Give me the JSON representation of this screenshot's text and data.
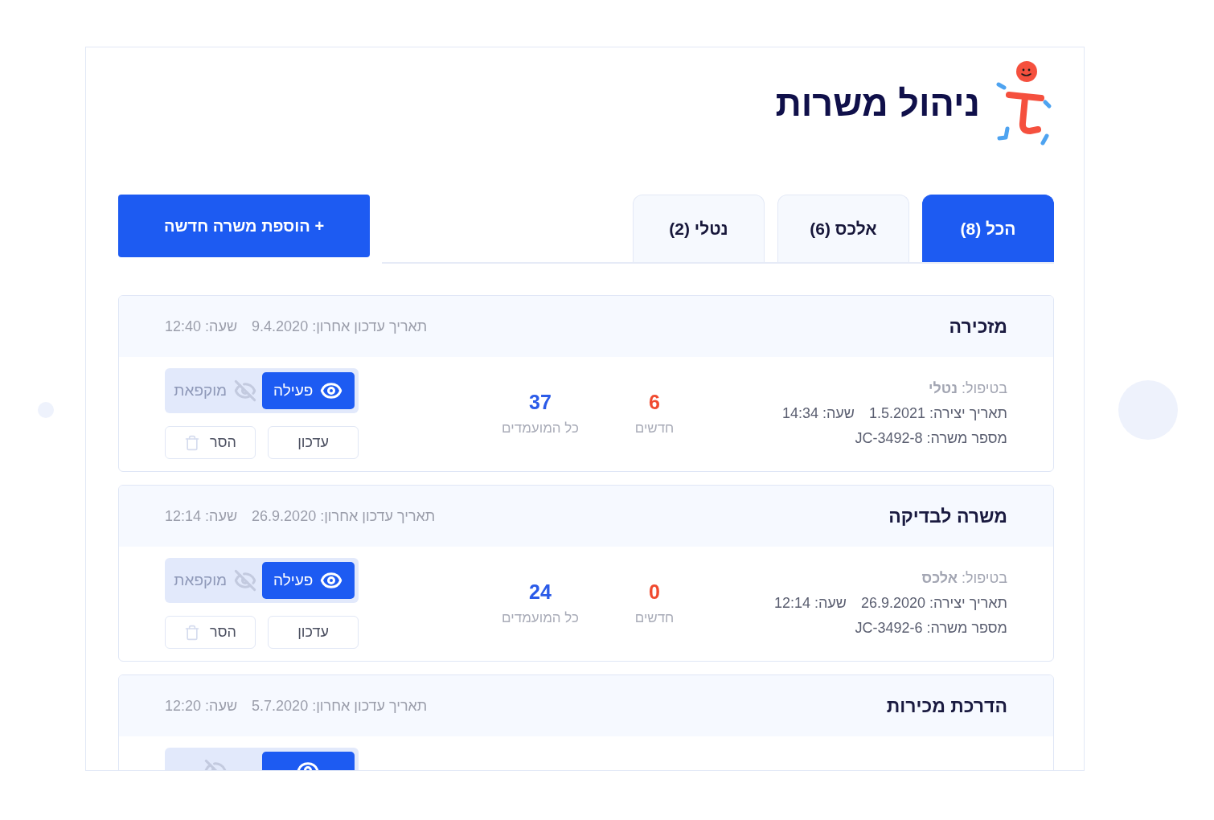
{
  "header": {
    "title": "ניהול משרות"
  },
  "tabs": [
    {
      "label": "הכל (8)",
      "selected": true
    },
    {
      "label": "אלכס (6)",
      "selected": false
    },
    {
      "label": "נטלי (2)",
      "selected": false
    }
  ],
  "add_button": {
    "label": "+ הוספת משרה חדשה"
  },
  "jobs": [
    {
      "title": "מזכירה",
      "last_update": "תאריך עדכון אחרון: 9.4.2020",
      "update_time": "שעה: 12:40",
      "assignee": "בטיפול: **נטלי**",
      "created": "תאריך יצירה: 1.5.2021",
      "created_time": "שעה: 14:34",
      "job_number": "מספר משרה: JC-3492-8",
      "stats": [
        {
          "kind": "new",
          "value": "6",
          "label": "חדשים"
        },
        {
          "kind": "total",
          "value": "37",
          "label": "כל המועמדים"
        }
      ],
      "status_options": [
        {
          "kind": "active",
          "label": "פעילה",
          "selected": true
        },
        {
          "kind": "frozen",
          "label": "מוקפאת",
          "selected": false
        }
      ],
      "actions": [
        {
          "kind": "edit",
          "label": "עדכון"
        },
        {
          "kind": "remove",
          "label": "הסר"
        }
      ]
    },
    {
      "title": "משרה לבדיקה",
      "last_update": "תאריך עדכון אחרון: 26.9.2020",
      "update_time": "שעה: 12:14",
      "assignee": "בטיפול: **אלכס**",
      "created": "תאריך יצירה: 26.9.2020",
      "created_time": "שעה: 12:14",
      "job_number": "מספר משרה: JC-3492-6",
      "stats": [
        {
          "kind": "new",
          "value": "0",
          "label": "חדשים"
        },
        {
          "kind": "total",
          "value": "24",
          "label": "כל המועמדים"
        }
      ],
      "status_options": [
        {
          "kind": "active",
          "label": "פעילה",
          "selected": true
        },
        {
          "kind": "frozen",
          "label": "מוקפאת",
          "selected": false
        }
      ],
      "actions": [
        {
          "kind": "edit",
          "label": "עדכון"
        },
        {
          "kind": "remove",
          "label": "הסר"
        }
      ]
    },
    {
      "title": "הדרכת מכירות",
      "last_update": "תאריך עדכון אחרון: 5.7.2020",
      "update_time": "שעה: 12:20",
      "status_options": [
        {
          "kind": "active",
          "selected": true
        },
        {
          "kind": "frozen",
          "selected": false
        }
      ]
    }
  ]
}
